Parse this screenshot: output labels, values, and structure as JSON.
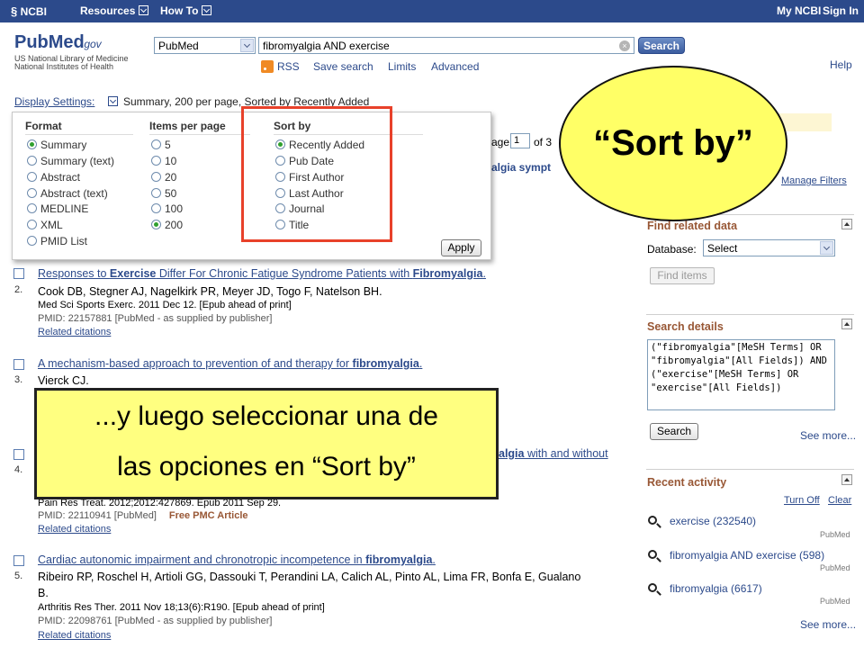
{
  "ncbi_bar": {
    "logo": "NCBI",
    "resources": "Resources",
    "how_to": "How To",
    "my_ncbi": "My NCBI",
    "sign_in": "Sign In"
  },
  "header": {
    "logo_pub": "PubMed",
    "logo_gov": ".gov",
    "sub1": "US National Library of Medicine",
    "sub2": "National Institutes of Health",
    "database": "PubMed",
    "search_value": "fibromyalgia AND exercise",
    "search_button": "Search",
    "links": [
      "RSS",
      "Save search",
      "Limits",
      "Advanced"
    ],
    "help": "Help"
  },
  "display": {
    "label": "Display Settings:",
    "summary": "Summary, 200 per page, Sorted by Recently Added",
    "format_head": "Format",
    "format_options": [
      "Summary",
      "Summary (text)",
      "Abstract",
      "Abstract (text)",
      "MEDLINE",
      "XML",
      "PMID List"
    ],
    "items_head": "Items per page",
    "items_options": [
      "5",
      "10",
      "20",
      "50",
      "100",
      "200"
    ],
    "sort_head": "Sort by",
    "sort_options": [
      "Recently Added",
      "Pub Date",
      "First Author",
      "Last Author",
      "Journal",
      "Title"
    ],
    "apply": "Apply"
  },
  "pager": {
    "label": "age",
    "page": "1",
    "of": "of 3"
  },
  "peek_title": "algia sympt",
  "results": [
    {
      "num": "",
      "title_pre": "Responses to ",
      "title_b1": "Exercise",
      "title_mid": " Differ For Chronic Fatigue Syndrome Patients with ",
      "title_b2": "Fibromyalgia",
      "title_post": ".",
      "authors": "Cook DB, Stegner AJ, Nagelkirk PR, Meyer JD, Togo F, Natelson BH.",
      "journal": "Med Sci Sports Exerc. 2011 Dec 12. [Epub ahead of print]",
      "pmid": "PMID: 22157881 [PubMed - as supplied by publisher]",
      "related": "Related citations"
    },
    {
      "num": "2.",
      "title_pre": "A mechanism-based approach to prevention of and therapy for ",
      "title_b1": "fibromyalgia",
      "title_post": ".",
      "authors": "Vierck CJ."
    },
    {
      "num": "3.",
      "title_b1": "algia",
      "title_post": " with and without",
      "journal": "Pain Res Treat. 2012;2012:427869. Epub 2011 Sep 29.",
      "pmid": "PMID: 22110941 [PubMed]",
      "free": "Free PMC Article",
      "related": "Related citations"
    },
    {
      "num": "4.",
      "title_pre": "Cardiac autonomic impairment and chronotropic incompetence in ",
      "title_b1": "fibromyalgia",
      "title_post": ".",
      "authors": "Ribeiro RP, Roschel H, Artioli GG, Dassouki T, Perandini LA, Calich AL, Pinto AL, Lima FR, Bonfa E, Gualano",
      "authors2": "B.",
      "journal": "Arthritis Res Ther. 2011 Nov 18;13(6):R190. [Epub ahead of print]",
      "pmid": "PMID: 22098761 [PubMed - as supplied by publisher]",
      "related": "Related citations"
    },
    {
      "num": "5."
    }
  ],
  "sidebar": {
    "manage_filters": "Manage Filters",
    "related_title": "Find related data",
    "database_label": "Database:",
    "database_value": "Select",
    "find_items": "Find items",
    "details_title": "Search details",
    "details_text": "(\"fibromyalgia\"[MeSH Terms] OR \"fibromyalgia\"[All Fields]) AND (\"exercise\"[MeSH Terms] OR \"exercise\"[All Fields])",
    "details_search": "Search",
    "see_more": "See more...",
    "recent_title": "Recent activity",
    "turn_off": "Turn Off",
    "clear": "Clear",
    "recent_items": [
      {
        "text": "exercise (232540)",
        "db": "PubMed"
      },
      {
        "text": "fibromyalgia AND exercise (598)",
        "db": "PubMed"
      },
      {
        "text": "fibromyalgia (6617)",
        "db": "PubMed"
      }
    ]
  },
  "callouts": {
    "sortby": "“Sort by”",
    "bottom_line1": "...y luego seleccionar una de",
    "bottom_line2": "las opciones en “Sort by”"
  },
  "colors": {
    "ncbi_blue": "#2c4a8b",
    "section_title": "#985735",
    "callout_yellow": "#ffff66",
    "highlight_red": "#e8412a"
  }
}
